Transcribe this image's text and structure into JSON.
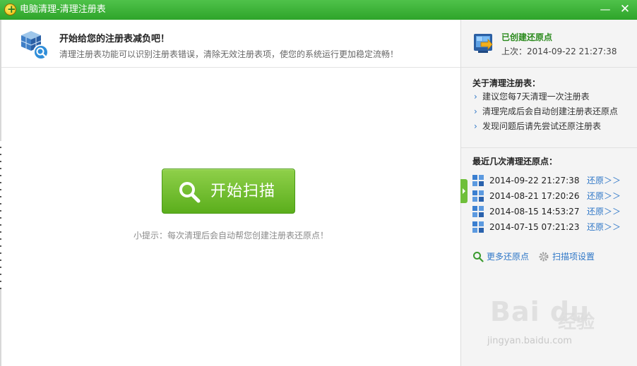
{
  "window": {
    "title": "电脑清理-清理注册表",
    "minimize_glyph": "—",
    "close_glyph": "✕"
  },
  "header": {
    "title": "开始给您的注册表减负吧！",
    "description": "清理注册表功能可以识别注册表错误，清除无效注册表项，使您的系统运行更加稳定流畅！"
  },
  "main": {
    "scan_button_label": "开始扫描",
    "hint": "小提示：每次清理后会自动帮您创建注册表还原点！"
  },
  "sidebar": {
    "status": {
      "title": "已创建还原点",
      "last_time": "上次：2014-09-22 21:27:38"
    },
    "about": {
      "title": "关于清理注册表：",
      "tips": [
        "建议您每7天清理一次注册表",
        "清理完成后会自动创建注册表还原点",
        "发现问题后请先尝试还原注册表"
      ]
    },
    "recent": {
      "title": "最近几次清理还原点：",
      "points": [
        {
          "time": "2014-09-22 21:27:38",
          "action": "还原＞＞"
        },
        {
          "time": "2014-08-21 17:20:26",
          "action": "还原＞＞"
        },
        {
          "time": "2014-08-15 14:53:27",
          "action": "还原＞＞"
        },
        {
          "time": "2014-07-15 07:21:23",
          "action": "还原＞＞"
        }
      ]
    },
    "more_points_label": "更多还原点",
    "scan_settings_label": "扫描项设置"
  },
  "watermark": {
    "brand": "Bai du",
    "cn": "经验",
    "url": "jingyan.baidu.com"
  },
  "colors": {
    "titlebar": "#3bb335",
    "accent_green": "#5bae1c",
    "link_blue": "#2f77c7",
    "status_green": "#2a8a1c"
  },
  "icons": [
    "app-logo-icon",
    "registry-cube-icon",
    "magnifier-icon",
    "restore-point-icon",
    "restore-list-icon",
    "search-icon",
    "gear-icon"
  ]
}
